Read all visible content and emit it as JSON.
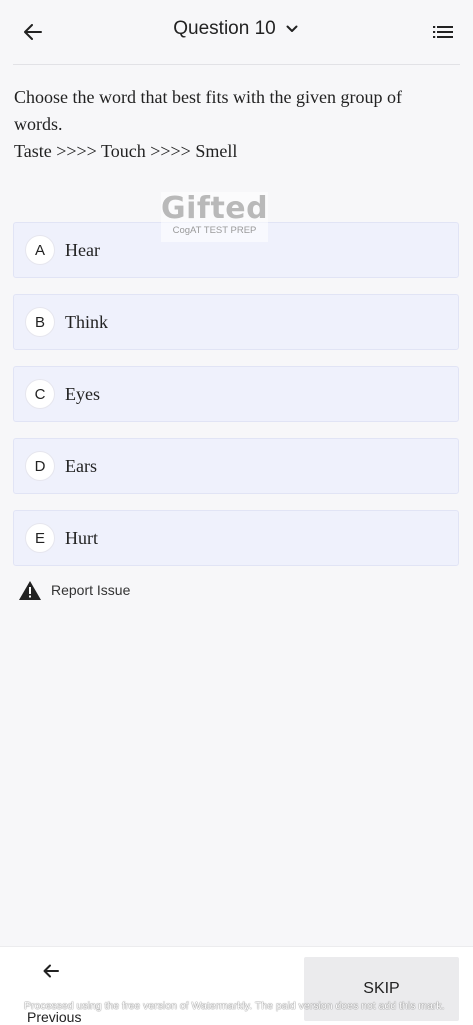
{
  "header": {
    "title": "Question 10",
    "back_icon": "arrow-left-icon",
    "dropdown_icon": "chevron-down-icon",
    "list_icon": "list-icon"
  },
  "question": {
    "prompt": "Choose the word that best fits with the given group of words.",
    "sequence": "Taste >>>> Touch >>>> Smell"
  },
  "watermark": {
    "logo_text": "Gifted",
    "subtitle": "CogAT TEST PREP"
  },
  "options": [
    {
      "letter": "A",
      "text": "Hear"
    },
    {
      "letter": "B",
      "text": "Think"
    },
    {
      "letter": "C",
      "text": "Eyes"
    },
    {
      "letter": "D",
      "text": "Ears"
    },
    {
      "letter": "E",
      "text": "Hurt"
    }
  ],
  "report": {
    "label": "Report Issue",
    "icon": "warning-icon"
  },
  "bottom": {
    "previous_label": "Previous",
    "skip_label": "SKIP"
  },
  "footer_note": "Processed using the free version of Watermarkly. The paid version does not add this mark.",
  "colors": {
    "background": "#f7f7f9",
    "option_bg": "#eff1fc",
    "skip_bg": "#ebebed"
  }
}
